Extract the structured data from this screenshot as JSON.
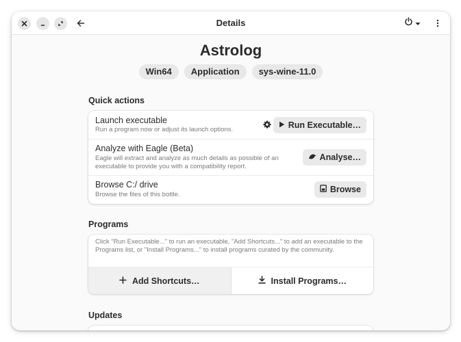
{
  "window": {
    "title": "Details"
  },
  "header": {
    "close_icon": "close-icon",
    "minimize_icon": "minimize-icon",
    "maximize_icon": "maximize-icon",
    "back_icon": "arrow-left-icon",
    "power_icon": "power-icon",
    "menu_icon": "kebab-menu-icon"
  },
  "app": {
    "name": "Astrolog",
    "tags": [
      "Win64",
      "Application",
      "sys-wine-11.0"
    ]
  },
  "quick_actions": {
    "title": "Quick actions",
    "rows": [
      {
        "title": "Launch executable",
        "subtitle": "Run a program now or adjust its launch options.",
        "button": "Run Executable…"
      },
      {
        "title": "Analyze with Eagle (Beta)",
        "subtitle": "Eagle will extract and analyze as much details as possible of an executable to provide you with a compatibility report.",
        "button": "Analyse…"
      },
      {
        "title": "Browse C:/ drive",
        "subtitle": "Browse the files of this bottle.",
        "button": "Browse"
      }
    ]
  },
  "programs": {
    "title": "Programs",
    "description": "Click \"Run Executable...\" to run an executable, \"Add Shortcuts...\" to add an executable to the Programs list, or \"Install Programs...\" to install programs curated by the community.",
    "add_shortcuts": "Add Shortcuts…",
    "install_programs": "Install Programs…"
  },
  "updates": {
    "title": "Updates"
  }
}
